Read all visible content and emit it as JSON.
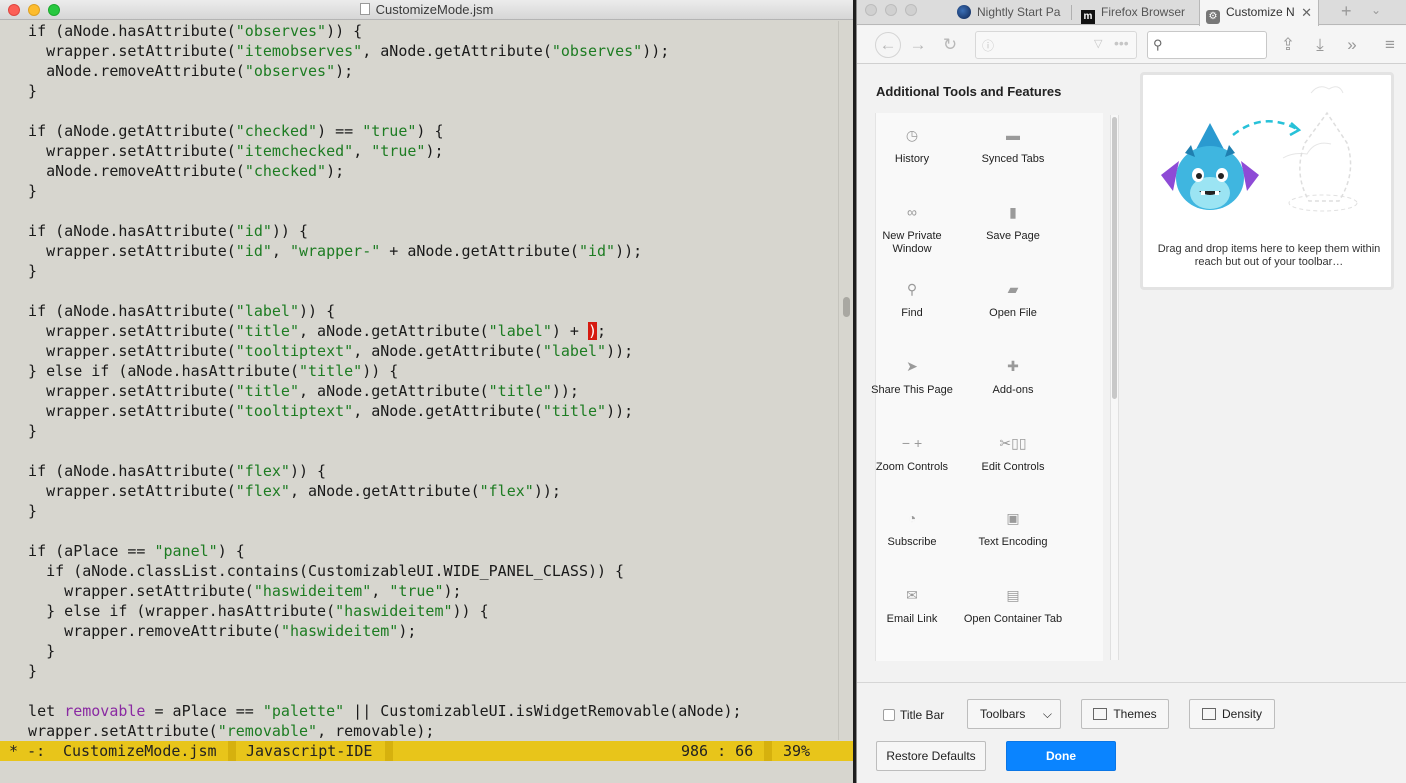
{
  "editor": {
    "title": "CustomizeMode.jsm",
    "code_lines": [
      [
        {
          "t": "  if (aNode.hasAttribute("
        },
        {
          "t": "\"observes\"",
          "c": "s"
        },
        {
          "t": ")) {"
        }
      ],
      [
        {
          "t": "    wrapper.setAttribute("
        },
        {
          "t": "\"itemobserves\"",
          "c": "s"
        },
        {
          "t": ", aNode.getAttribute("
        },
        {
          "t": "\"observes\"",
          "c": "s"
        },
        {
          "t": "));"
        }
      ],
      [
        {
          "t": "    aNode.removeAttribute("
        },
        {
          "t": "\"observes\"",
          "c": "s"
        },
        {
          "t": ");"
        }
      ],
      [
        {
          "t": "  }"
        }
      ],
      [
        {
          "t": ""
        }
      ],
      [
        {
          "t": "  if (aNode.getAttribute("
        },
        {
          "t": "\"checked\"",
          "c": "s"
        },
        {
          "t": ") == "
        },
        {
          "t": "\"true\"",
          "c": "s"
        },
        {
          "t": ") {"
        }
      ],
      [
        {
          "t": "    wrapper.setAttribute("
        },
        {
          "t": "\"itemchecked\"",
          "c": "s"
        },
        {
          "t": ", "
        },
        {
          "t": "\"true\"",
          "c": "s"
        },
        {
          "t": ");"
        }
      ],
      [
        {
          "t": "    aNode.removeAttribute("
        },
        {
          "t": "\"checked\"",
          "c": "s"
        },
        {
          "t": ");"
        }
      ],
      [
        {
          "t": "  }"
        }
      ],
      [
        {
          "t": ""
        }
      ],
      [
        {
          "t": "  if (aNode.hasAttribute("
        },
        {
          "t": "\"id\"",
          "c": "s"
        },
        {
          "t": ")) {"
        }
      ],
      [
        {
          "t": "    wrapper.setAttribute("
        },
        {
          "t": "\"id\"",
          "c": "s"
        },
        {
          "t": ", "
        },
        {
          "t": "\"wrapper-\"",
          "c": "s"
        },
        {
          "t": " + aNode.getAttribute("
        },
        {
          "t": "\"id\"",
          "c": "s"
        },
        {
          "t": "));"
        }
      ],
      [
        {
          "t": "  }"
        }
      ],
      [
        {
          "t": ""
        }
      ],
      [
        {
          "t": "  if (aNode.hasAttribute("
        },
        {
          "t": "\"label\"",
          "c": "s"
        },
        {
          "t": ")) {"
        }
      ],
      [
        {
          "t": "    wrapper.setAttribute("
        },
        {
          "t": "\"title\"",
          "c": "s"
        },
        {
          "t": ", aNode.getAttribute("
        },
        {
          "t": "\"label\"",
          "c": "s"
        },
        {
          "t": ") + "
        },
        {
          "t": ")",
          "c": "cursor"
        },
        {
          "t": ";"
        }
      ],
      [
        {
          "t": "    wrapper.setAttribute("
        },
        {
          "t": "\"tooltiptext\"",
          "c": "s"
        },
        {
          "t": ", aNode.getAttribute("
        },
        {
          "t": "\"label\"",
          "c": "s"
        },
        {
          "t": "));"
        }
      ],
      [
        {
          "t": "  } else if (aNode.hasAttribute("
        },
        {
          "t": "\"title\"",
          "c": "s"
        },
        {
          "t": ")) {"
        }
      ],
      [
        {
          "t": "    wrapper.setAttribute("
        },
        {
          "t": "\"title\"",
          "c": "s"
        },
        {
          "t": ", aNode.getAttribute("
        },
        {
          "t": "\"title\"",
          "c": "s"
        },
        {
          "t": "));"
        }
      ],
      [
        {
          "t": "    wrapper.setAttribute("
        },
        {
          "t": "\"tooltiptext\"",
          "c": "s"
        },
        {
          "t": ", aNode.getAttribute("
        },
        {
          "t": "\"title\"",
          "c": "s"
        },
        {
          "t": "));"
        }
      ],
      [
        {
          "t": "  }"
        }
      ],
      [
        {
          "t": ""
        }
      ],
      [
        {
          "t": "  if (aNode.hasAttribute("
        },
        {
          "t": "\"flex\"",
          "c": "s"
        },
        {
          "t": ")) {"
        }
      ],
      [
        {
          "t": "    wrapper.setAttribute("
        },
        {
          "t": "\"flex\"",
          "c": "s"
        },
        {
          "t": ", aNode.getAttribute("
        },
        {
          "t": "\"flex\"",
          "c": "s"
        },
        {
          "t": "));"
        }
      ],
      [
        {
          "t": "  }"
        }
      ],
      [
        {
          "t": ""
        }
      ],
      [
        {
          "t": "  if (aPlace == "
        },
        {
          "t": "\"panel\"",
          "c": "s"
        },
        {
          "t": ") {"
        }
      ],
      [
        {
          "t": "    if (aNode.classList.contains(CustomizableUI.WIDE_PANEL_CLASS)) {"
        }
      ],
      [
        {
          "t": "      wrapper.setAttribute("
        },
        {
          "t": "\"haswideitem\"",
          "c": "s"
        },
        {
          "t": ", "
        },
        {
          "t": "\"true\"",
          "c": "s"
        },
        {
          "t": ");"
        }
      ],
      [
        {
          "t": "    } else if (wrapper.hasAttribute("
        },
        {
          "t": "\"haswideitem\"",
          "c": "s"
        },
        {
          "t": ")) {"
        }
      ],
      [
        {
          "t": "      wrapper.removeAttribute("
        },
        {
          "t": "\"haswideitem\"",
          "c": "s"
        },
        {
          "t": ");"
        }
      ],
      [
        {
          "t": "    }"
        }
      ],
      [
        {
          "t": "  }"
        }
      ],
      [
        {
          "t": ""
        }
      ],
      [
        {
          "t": "  let "
        },
        {
          "t": "removable",
          "c": "k"
        },
        {
          "t": " = aPlace == "
        },
        {
          "t": "\"palette\"",
          "c": "s"
        },
        {
          "t": " || CustomizableUI.isWidgetRemovable(aNode);"
        }
      ],
      [
        {
          "t": "  wrapper.setAttribute("
        },
        {
          "t": "\"removable\"",
          "c": "s"
        },
        {
          "t": ", removable);"
        }
      ]
    ],
    "modeline": {
      "status": " * -:",
      "buffer": "CustomizeMode.jsm",
      "mode": "Javascript-IDE",
      "position": "986 : 66",
      "percent": "39%"
    },
    "colors": {
      "string": "#1d7c22",
      "keyword": "#8a2aa2",
      "modeline": "#e8c51a",
      "cursor": "#d51a10"
    }
  },
  "firefox": {
    "tabs": [
      {
        "label": "Nightly Start Pa",
        "icon": "nightly-globe-icon"
      },
      {
        "label": "Firefox Browser",
        "icon": "mdn-icon"
      },
      {
        "label": "Customize N",
        "icon": "gear-icon",
        "active": true
      }
    ],
    "palette_title": "Additional Tools and Features",
    "palette_items": [
      {
        "label": "History",
        "icon": "clock-icon"
      },
      {
        "label": "Synced Tabs",
        "icon": "synced-tabs-icon"
      },
      {
        "label": "New Private Window",
        "icon": "mask-icon"
      },
      {
        "label": "Save Page",
        "icon": "page-icon"
      },
      {
        "label": "Find",
        "icon": "search-icon"
      },
      {
        "label": "Open File",
        "icon": "folder-icon"
      },
      {
        "label": "Share This Page",
        "icon": "share-icon"
      },
      {
        "label": "Add-ons",
        "icon": "puzzle-icon"
      },
      {
        "label": "Zoom Controls",
        "icon": "zoom-icon"
      },
      {
        "label": "Edit Controls",
        "icon": "edit-icon"
      },
      {
        "label": "Subscribe",
        "icon": "rss-icon"
      },
      {
        "label": "Text Encoding",
        "icon": "encoding-icon"
      },
      {
        "label": "Email Link",
        "icon": "email-icon"
      },
      {
        "label": "Open Container Tab",
        "icon": "container-tab-icon"
      }
    ],
    "overflow_text": "Drag and drop items here to keep them within reach but out of your toolbar…",
    "bottom": {
      "title_bar": "Title Bar",
      "toolbars": "Toolbars",
      "themes": "Themes",
      "density": "Density",
      "restore": "Restore Defaults",
      "done": "Done"
    },
    "colors": {
      "accent": "#0a84ff"
    }
  }
}
